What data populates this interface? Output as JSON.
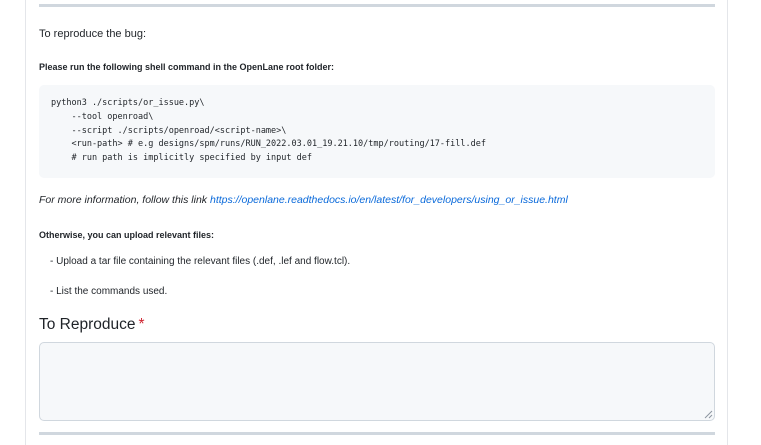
{
  "section": {
    "heading": "To reproduce the bug:",
    "instructions": "Please run the following shell command in the OpenLane root folder:",
    "code_lines": [
      "python3 ./scripts/or_issue.py\\",
      "    --tool openroad\\",
      "    --script ./scripts/openroad/<script-name>\\",
      "    <run-path> # e.g designs/spm/runs/RUN_2022.03.01_19.21.10/tmp/routing/17-fill.def",
      "    # run path is implicitly specified by input def"
    ],
    "more_info_prefix": "For more information, follow this link ",
    "more_info_link": "https://openlane.readthedocs.io/en/latest/for_developers/using_or_issue.html",
    "otherwise": "Otherwise, you can upload relevant files:",
    "bullets": [
      "- Upload a tar file containing the relevant files (.def, .lef and flow.tcl).",
      "- List the commands used."
    ]
  },
  "field": {
    "label": "To Reproduce",
    "required_mark": "*",
    "value": ""
  },
  "colors": {
    "link": "#0969da",
    "required": "#cf222e",
    "code_bg": "#f6f8fa",
    "border": "#d0d7de"
  }
}
